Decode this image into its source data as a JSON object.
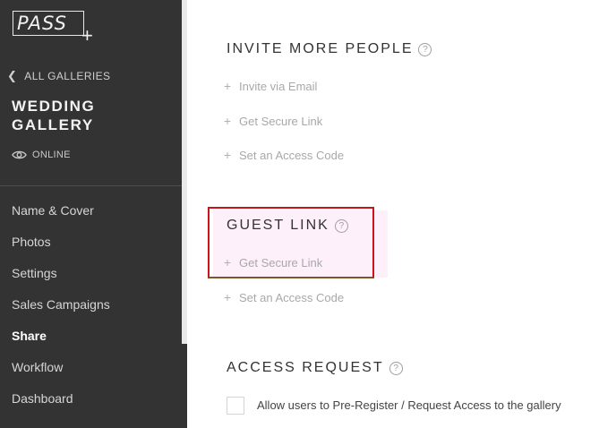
{
  "sidebar": {
    "logo_text": "PASS",
    "logo_plus": "+",
    "back_label": "ALL GALLERIES",
    "gallery_title": "WEDDING GALLERY",
    "status": "ONLINE",
    "nav": [
      "Name & Cover",
      "Photos",
      "Settings",
      "Sales Campaigns",
      "Share",
      "Workflow",
      "Dashboard"
    ],
    "active_nav": "Share"
  },
  "main": {
    "invite": {
      "title": "INVITE MORE PEOPLE",
      "options": [
        "Invite via Email",
        "Get Secure Link",
        "Set an Access Code"
      ]
    },
    "guest_link": {
      "title": "GUEST LINK",
      "options": [
        "Get Secure Link",
        "Set an Access Code"
      ]
    },
    "access_request": {
      "title": "ACCESS REQUEST",
      "checkbox_label": "Allow users to Pre-Register / Request Access to the gallery",
      "checked": false
    },
    "help_glyph": "?"
  },
  "colors": {
    "sidebar_bg": "#333333",
    "highlight_border": "#d0121b",
    "highlight_bg": "#fdf0fa"
  }
}
